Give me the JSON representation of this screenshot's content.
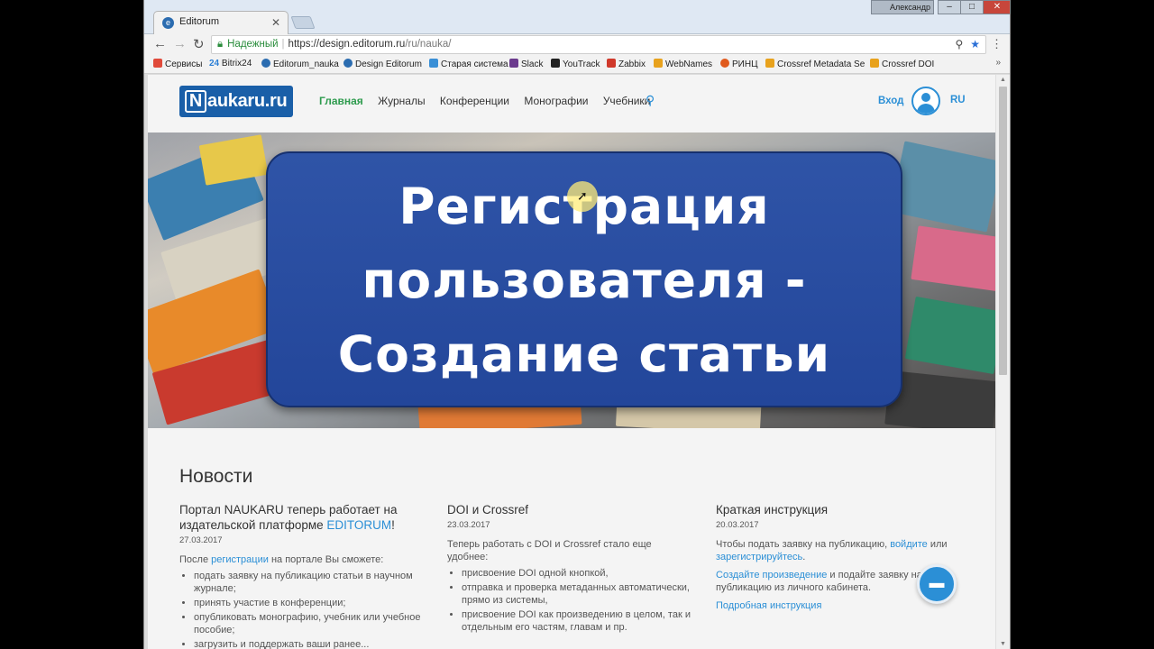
{
  "browser": {
    "tab_title": "Editorum",
    "user_badge": "Александр",
    "security_label": "Надежный",
    "url_base": "https://design.editorum.ru",
    "url_path": "/ru/nauka/",
    "bookmarks": [
      {
        "label": "Сервисы",
        "color": "#e04a3a"
      },
      {
        "label": "Bitrix24",
        "color": "#2b7fd6"
      },
      {
        "label": "Editorum_nauka",
        "color": "#2b6cb0"
      },
      {
        "label": "Design Editorum",
        "color": "#2b6cb0"
      },
      {
        "label": "Старая система",
        "color": "#3a8fd6"
      },
      {
        "label": "Slack",
        "color": "#6b3a8d"
      },
      {
        "label": "YouTrack",
        "color": "#222222"
      },
      {
        "label": "Zabbix",
        "color": "#d0392b"
      },
      {
        "label": "WebNames",
        "color": "#e8a21d"
      },
      {
        "label": "РИНЦ",
        "color": "#e05a1d"
      },
      {
        "label": "Crossref Metadata Se",
        "color": "#e8a21d"
      },
      {
        "label": "Crossref DOI",
        "color": "#e8a21d"
      }
    ],
    "bookmark_prefix_24": "24"
  },
  "site": {
    "logo_letter": "N",
    "logo_text": "aukaru.ru",
    "nav": [
      "Главная",
      "Журналы",
      "Конференции",
      "Монографии",
      "Учебники"
    ],
    "login": "Вход",
    "lang": "RU"
  },
  "hero": {
    "line1": "Регистрация",
    "line2": "пользователя -",
    "line3": "Создание статьи"
  },
  "news": {
    "title": "Новости",
    "items": [
      {
        "title_part1": "Портал NAUKARU теперь работает на издательской платформе ",
        "title_link": "EDITORUM",
        "title_part2": "!",
        "date": "27.03.2017",
        "intro_part1": "После ",
        "intro_link": "регистрации",
        "intro_part2": " на портале Вы сможете:",
        "bullets": [
          "подать заявку на публикацию статьи в научном журнале;",
          "принять участие в конференции;",
          "опубликовать монографию, учебник или учебное пособие;",
          "загрузить и поддержать ваши ранее..."
        ]
      },
      {
        "title": "DOI и Crossref",
        "date": "23.03.2017",
        "intro": "Теперь работать с DOI и Crossref стало еще удобнее:",
        "bullets": [
          "присвоение DOI одной кнопкой,",
          "отправка и проверка метаданных автоматически, прямо из системы,",
          "присвоение DOI как произведению в целом, так и отдельным его частям, главам и пр."
        ]
      },
      {
        "title": "Краткая инструкция",
        "date": "20.03.2017",
        "p1_part1": "Чтобы подать заявку на публикацию, ",
        "p1_link1": "войдите",
        "p1_part2": " или ",
        "p1_link2": "зарегистрируйтесь",
        "p1_part3": ".",
        "p2_link": "Создайте произведение",
        "p2_part": " и подайте заявку на публикацию из личного кабинета.",
        "p3_link": "Подробная инструкция"
      }
    ]
  }
}
